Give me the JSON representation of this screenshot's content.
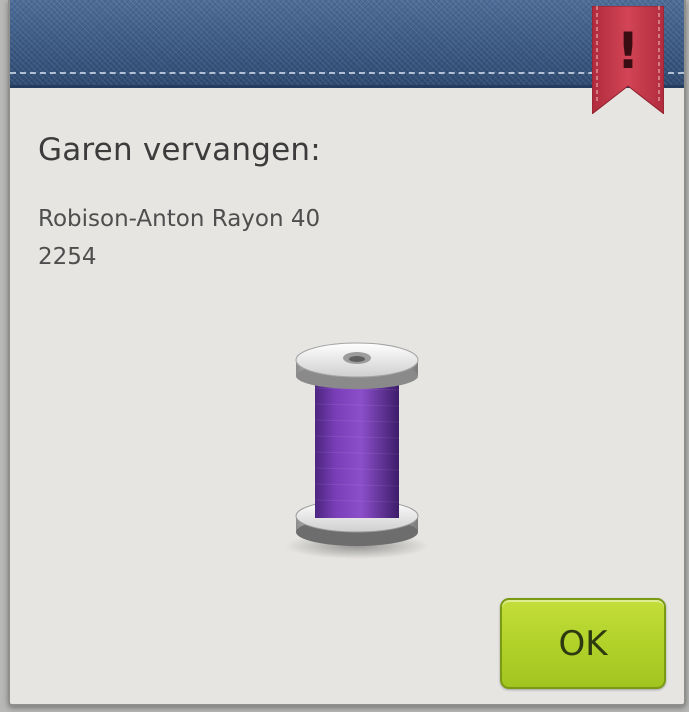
{
  "dialog": {
    "title": "Garen vervangen:",
    "thread_brand": "Robison-Anton Rayon 40",
    "thread_number": "2254",
    "alert_glyph": "!",
    "ok_label": "OK"
  },
  "icons": {
    "alert": "exclamation-ribbon-icon",
    "thread": "thread-spool-icon"
  },
  "colors": {
    "header": "#3d5c86",
    "ribbon": "#c8384a",
    "thread": "#7a3fb0",
    "ok_button": "#b2d22a",
    "background": "#e6e5e2"
  }
}
